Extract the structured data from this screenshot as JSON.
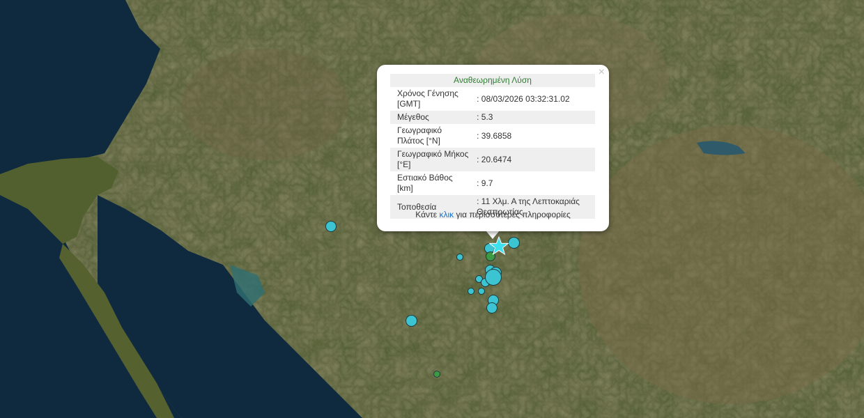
{
  "popup": {
    "title": "Αναθεωρημένη Λύση",
    "close_symbol": "×",
    "rows": [
      {
        "label": "Χρόνος Γένησης [GMT]",
        "value": ": 08/03/2026 03:32:31.02"
      },
      {
        "label": "Μέγεθος",
        "value": ": 5.3"
      },
      {
        "label": "Γεωγραφικό Πλάτος [°N]",
        "value": ": 39.6858"
      },
      {
        "label": "Γεωγραφικό Μήκος [°E]",
        "value": ": 20.6474"
      },
      {
        "label": "Εστιακό Βάθος [km]",
        "value": ": 9.7"
      },
      {
        "label": "Τοποθεσία",
        "value": ": 11 Χλμ. Α της Λεπτοκαριάς Θεσπρωτίας"
      }
    ],
    "more_prefix": "Κάντε ",
    "more_link": "κλικ",
    "more_suffix": " για περισσότερες πληροφορίες"
  },
  "colors": {
    "marker_cyan": "#3cc4d3",
    "marker_green": "#3b9a43",
    "star": "#3ee0ee",
    "title_green": "#2e7d32",
    "link_blue": "#1a73c8"
  },
  "map": {
    "main_event_icon": "star-icon",
    "marker_icon": "earthquake-circle-icon"
  }
}
